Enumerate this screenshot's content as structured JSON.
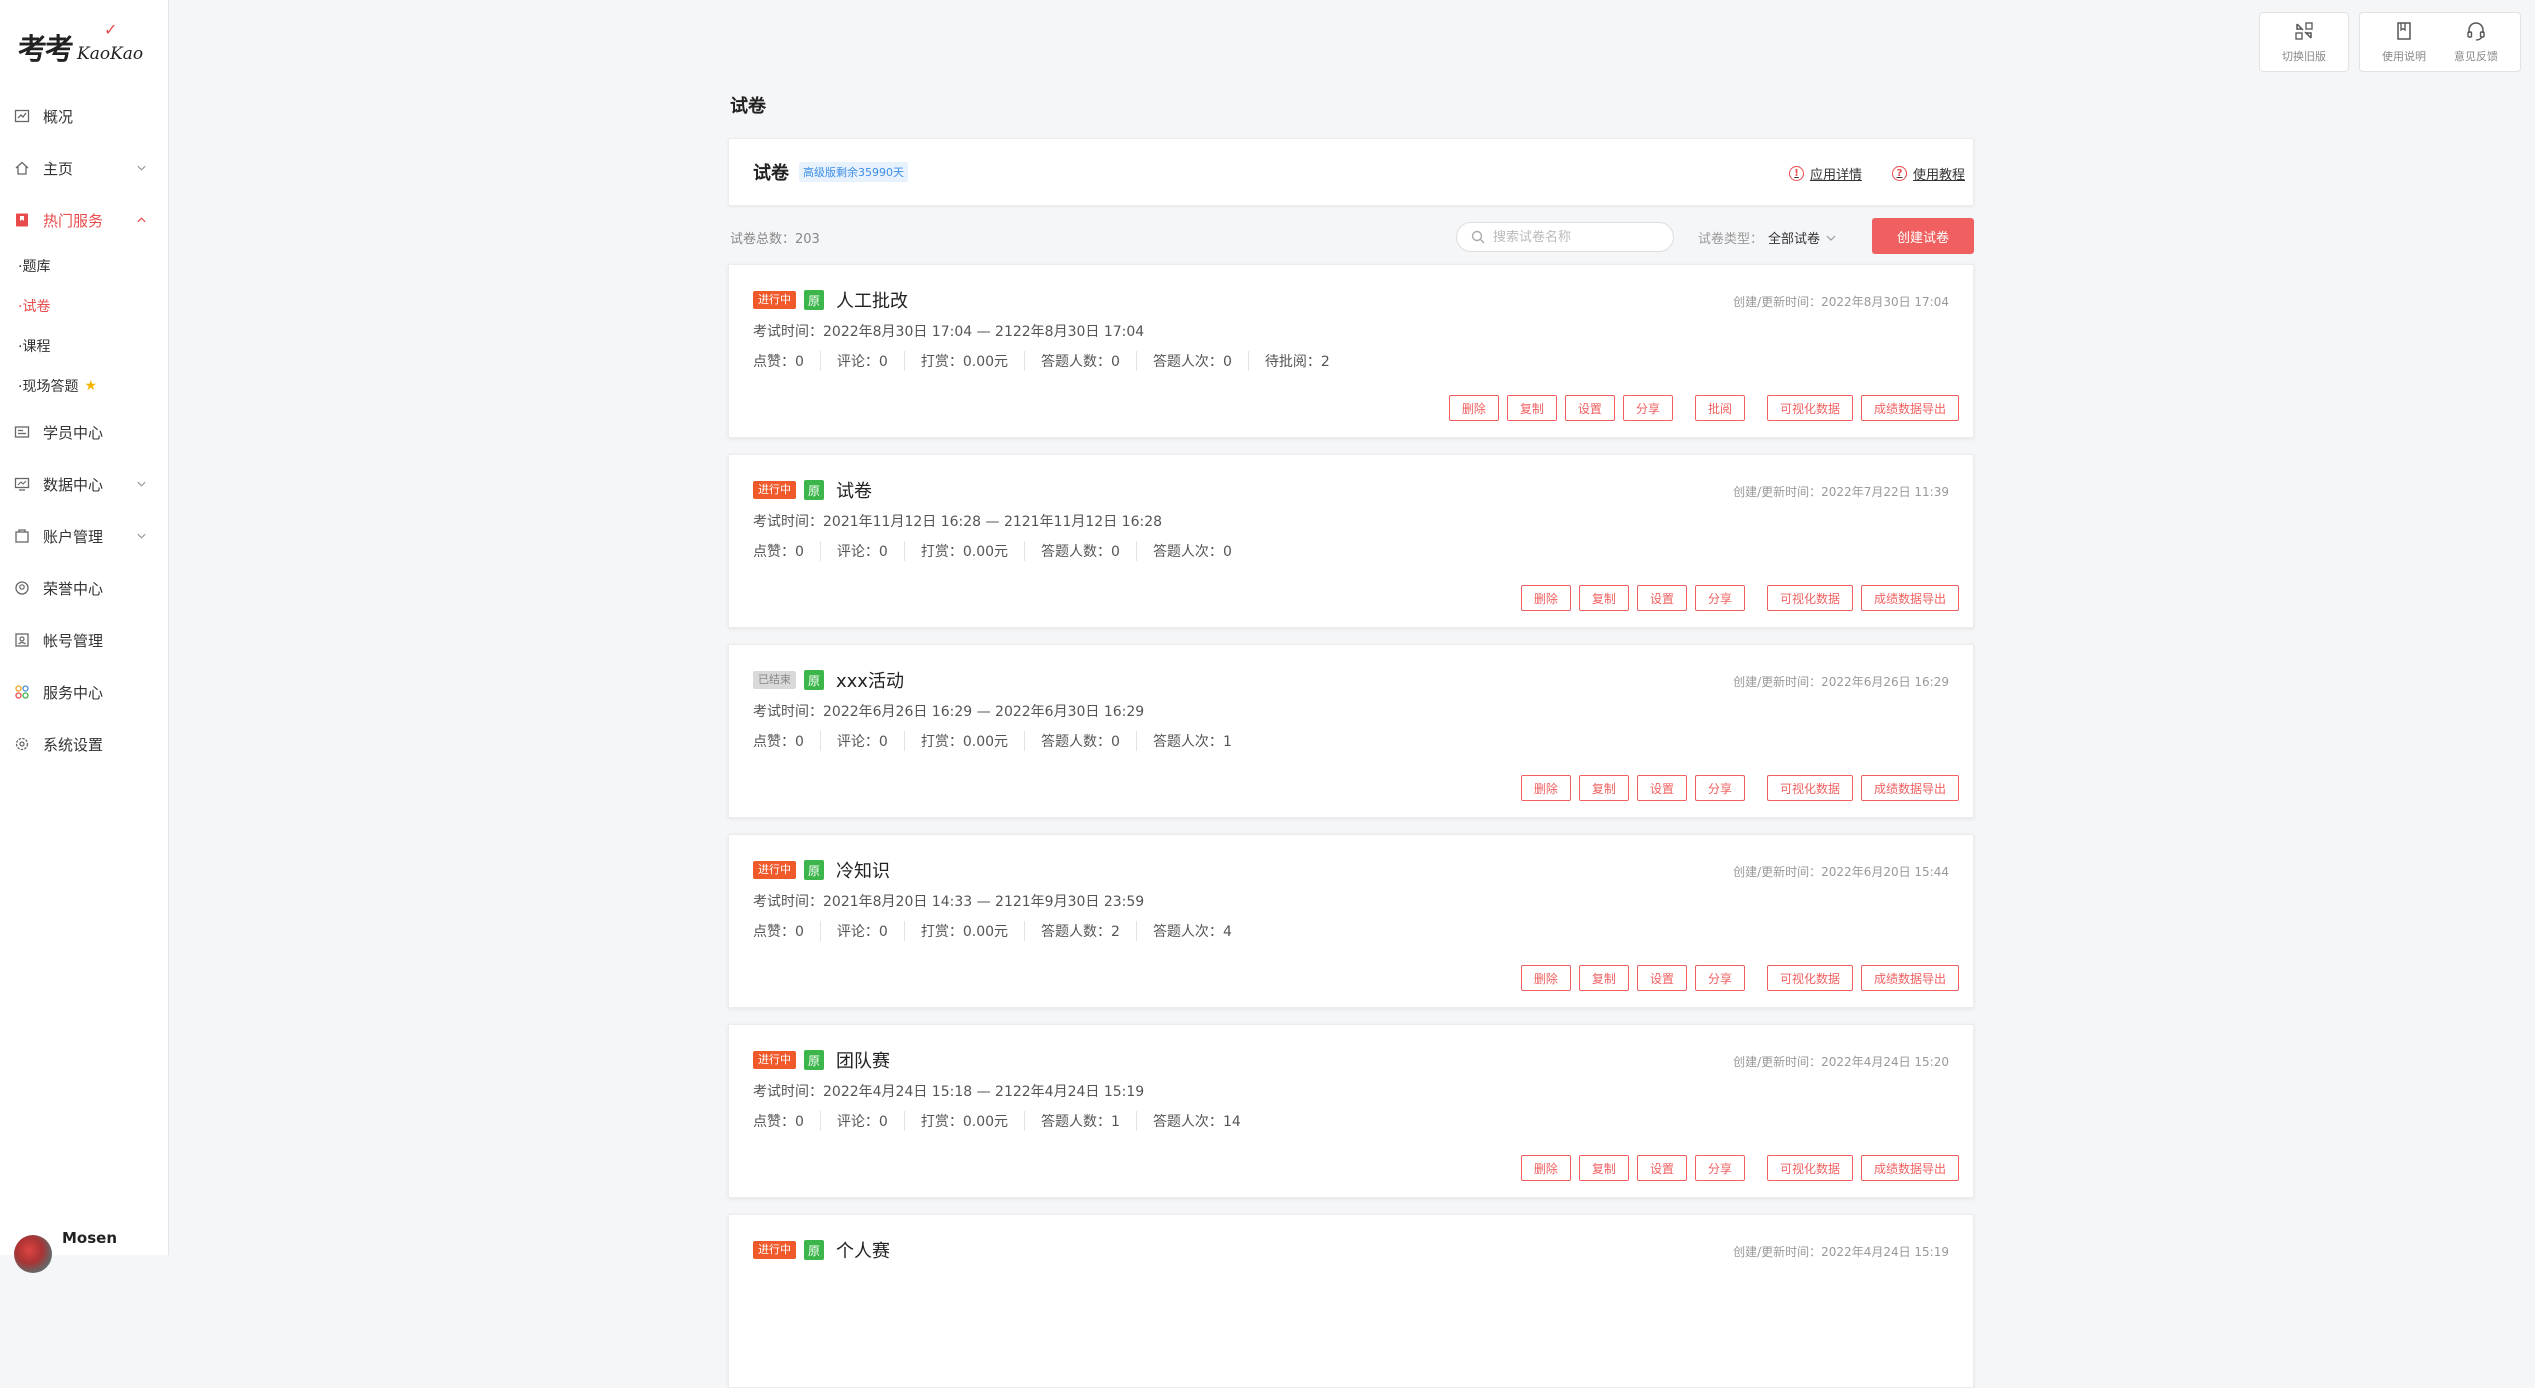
{
  "brand": {
    "cn": "考考",
    "en": "KaoKao"
  },
  "sidebar": {
    "items": [
      {
        "label": "概况"
      },
      {
        "label": "主页"
      },
      {
        "label": "热门服务"
      },
      {
        "label": "学员中心"
      },
      {
        "label": "数据中心"
      },
      {
        "label": "账户管理"
      },
      {
        "label": "荣誉中心"
      },
      {
        "label": "帐号管理"
      },
      {
        "label": "服务中心"
      },
      {
        "label": "系统设置"
      }
    ],
    "sub_items": [
      {
        "label": "·题库"
      },
      {
        "label": "·试卷"
      },
      {
        "label": "·课程"
      },
      {
        "label": "·现场答题"
      }
    ]
  },
  "user": {
    "name": "Mosen"
  },
  "tools": [
    {
      "label": "切换旧版",
      "icon": "switch-icon"
    },
    {
      "label": "使用说明",
      "icon": "book-icon"
    },
    {
      "label": "意见反馈",
      "icon": "headset-icon"
    }
  ],
  "main": {
    "page_title": "试卷",
    "header_title": "试卷",
    "badge": "高级版剩余35990天",
    "link_detail": "应用详情",
    "link_tutorial": "使用教程",
    "total": "试卷总数：203",
    "search_placeholder": "搜索试卷名称",
    "type_label": "试卷类型：",
    "type_value": "全部试卷",
    "create_button": "创建试卷"
  },
  "labels": {
    "exam_time": "考试时间：",
    "ctime": "创建/更新时间：",
    "likes": "点赞：",
    "comments": "评论：",
    "reward": "打赏：",
    "answerers": "答题人数：",
    "attempts": "答题人次：",
    "pending": "待批阅："
  },
  "actions": {
    "delete": "删除",
    "copy": "复制",
    "settings": "设置",
    "share": "分享",
    "review": "批阅",
    "visual": "可视化数据",
    "export": "成绩数据导出"
  },
  "papers": [
    {
      "status": "进行中",
      "tag": "原",
      "title": "人工批改",
      "ctime": "2022年8月30日 17:04",
      "exam_time": "2022年8月30日 17:04 — 2122年8月30日 17:04",
      "likes": "0",
      "comments": "0",
      "reward": "0.00元",
      "answerers": "0",
      "attempts": "0",
      "pending": "2"
    },
    {
      "status": "进行中",
      "tag": "原",
      "title": "试卷",
      "ctime": "2022年7月22日 11:39",
      "exam_time": "2021年11月12日 16:28 — 2121年11月12日 16:28",
      "likes": "0",
      "comments": "0",
      "reward": "0.00元",
      "answerers": "0",
      "attempts": "0"
    },
    {
      "status": "已结束",
      "tag": "原",
      "title": "xxx活动",
      "ctime": "2022年6月26日 16:29",
      "exam_time": "2022年6月26日 16:29 — 2022年6月30日 16:29",
      "likes": "0",
      "comments": "0",
      "reward": "0.00元",
      "answerers": "0",
      "attempts": "1"
    },
    {
      "status": "进行中",
      "tag": "原",
      "title": "冷知识",
      "ctime": "2022年6月20日 15:44",
      "exam_time": "2021年8月20日 14:33 — 2121年9月30日 23:59",
      "likes": "0",
      "comments": "0",
      "reward": "0.00元",
      "answerers": "2",
      "attempts": "4"
    },
    {
      "status": "进行中",
      "tag": "原",
      "title": "团队赛",
      "ctime": "2022年4月24日 15:20",
      "exam_time": "2022年4月24日 15:18 — 2122年4月24日 15:19",
      "likes": "0",
      "comments": "0",
      "reward": "0.00元",
      "answerers": "1",
      "attempts": "14"
    },
    {
      "status": "进行中",
      "tag": "原",
      "title": "个人赛",
      "ctime": "2022年4月24日 15:19"
    }
  ]
}
